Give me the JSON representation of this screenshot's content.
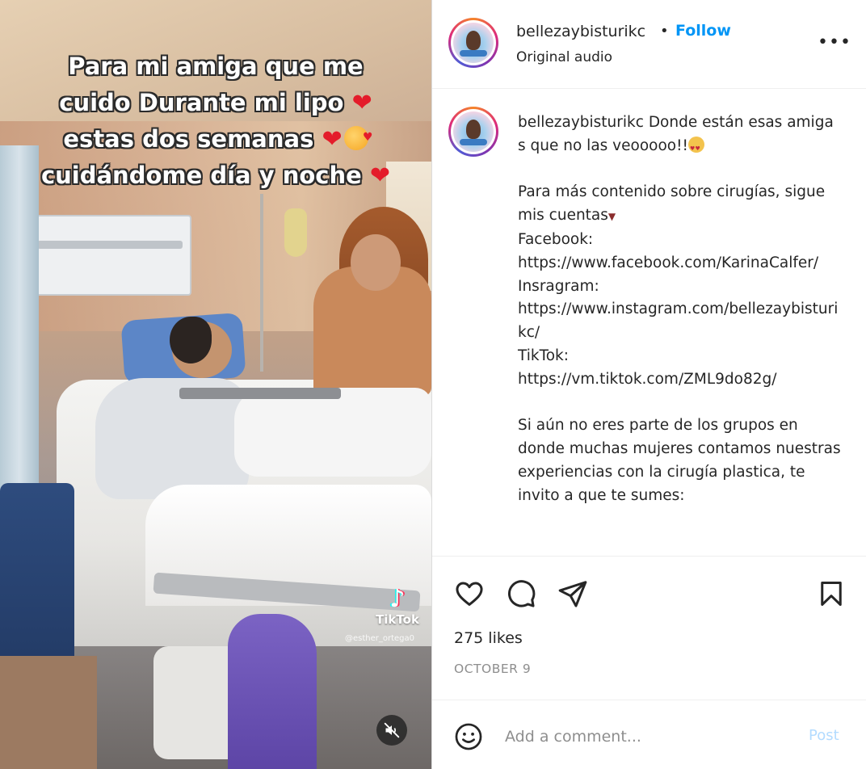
{
  "media": {
    "overlay_lines": [
      "Para mi amiga que me",
      "cuido Durante mi lipo",
      "estas dos semanas",
      "cuidándome día y noche"
    ],
    "watermark_brand": "TikTok",
    "watermark_handle": "@esther_ortega0",
    "mute_icon": "speaker-muted-icon"
  },
  "header": {
    "username": "bellezaybisturikc",
    "separator": "•",
    "follow_label": "Follow",
    "subtitle": "Original audio",
    "more_label": "•••"
  },
  "caption": {
    "username": "bellezaybisturikc",
    "intro": "Donde están esas amigas que no las veooooo!!",
    "line_more": "Para más contenido sobre cirugías, sigue mis cuentas",
    "facebook_label": "Facebook:",
    "facebook_url": "https://www.facebook.com/KarinaCalfer/",
    "instagram_label": "Insragram:",
    "instagram_url": "https://www.instagram.com/bellezaybisturikc/",
    "tiktok_label": "TikTok:",
    "tiktok_url": "https://vm.tiktok.com/ZML9do82g/",
    "closing": "Si aún no eres parte de los grupos en donde muchas mujeres contamos nuestras experiencias con la cirugía plastica, te invito a que te sumes:"
  },
  "actions": {
    "likes": "275 likes",
    "date": "OCTOBER 9"
  },
  "comment": {
    "placeholder": "Add a comment...",
    "post_label": "Post"
  },
  "colors": {
    "link_blue": "#0095f6",
    "post_disabled": "#b3dbff",
    "secondary_text": "#8e8e8e",
    "heart_red": "#e41c2a"
  }
}
